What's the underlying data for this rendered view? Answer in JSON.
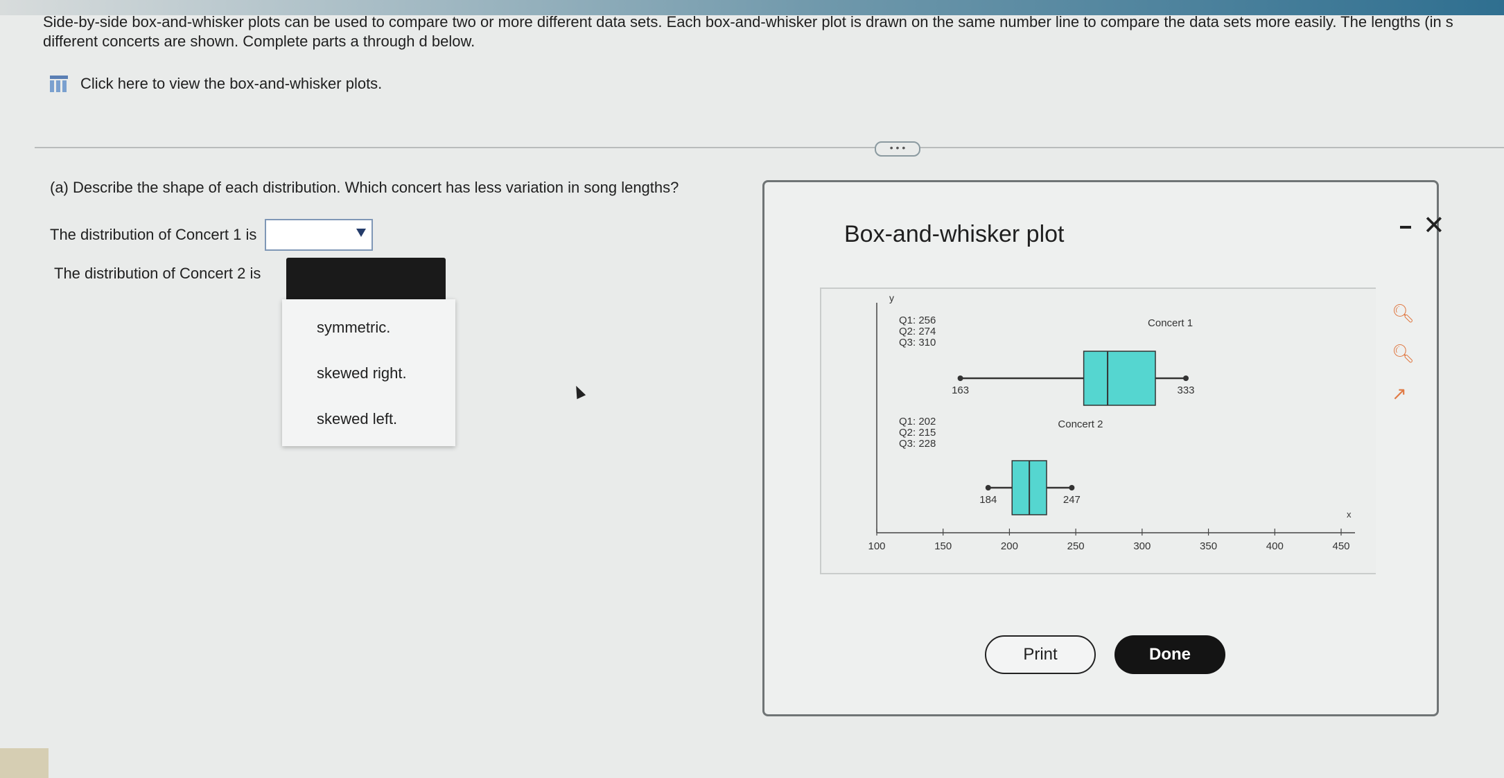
{
  "intro": {
    "text": "Side-by-side box-and-whisker plots can be used to compare two or more different data sets. Each box-and-whisker plot is drawn on the same number line to compare the data sets more easily. The lengths (in s\ndifferent concerts are shown. Complete parts a through d below."
  },
  "view_link": {
    "label": "Click here to view the box-and-whisker plots."
  },
  "more_pill": "• • •",
  "question": {
    "label": "(a) Describe the shape of each distribution. Which concert has less variation in song lengths?",
    "concert1_prompt": "The distribution of Concert 1 is",
    "concert2_prompt": "The distribution of Concert 2 is"
  },
  "dropdown": {
    "options": [
      "symmetric.",
      "skewed right.",
      "skewed left."
    ]
  },
  "modal": {
    "title": "Box-and-whisker plot",
    "print_label": "Print",
    "done_label": "Done"
  },
  "chart_data": {
    "type": "boxplot",
    "xlabel": "x",
    "ylabel": "y",
    "xlim": [
      100,
      450
    ],
    "xticks": [
      100,
      150,
      200,
      250,
      300,
      350,
      400,
      450
    ],
    "box_color": "#55d6d0",
    "series": [
      {
        "name": "Concert 1",
        "min": 163,
        "q1": 256,
        "median": 274,
        "q3": 310,
        "max": 333,
        "quartile_labels": [
          "Q1: 256",
          "Q2: 274",
          "Q3: 310"
        ]
      },
      {
        "name": "Concert 2",
        "min": 184,
        "q1": 202,
        "median": 215,
        "q3": 228,
        "max": 247,
        "quartile_labels": [
          "Q1: 202",
          "Q2: 215",
          "Q3: 228"
        ]
      }
    ]
  }
}
